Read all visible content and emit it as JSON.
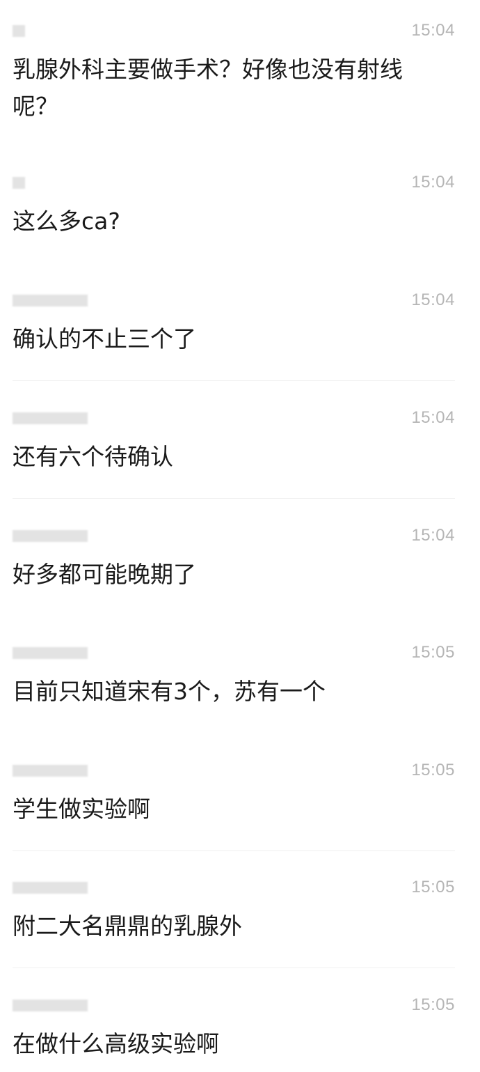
{
  "messages": [
    {
      "time": "15:04",
      "text": "乳腺外科主要做手术？好像也没有射线呢？"
    },
    {
      "time": "15:04",
      "text": "这么多ca?"
    },
    {
      "time": "15:04",
      "text": "确认的不止三个了"
    },
    {
      "time": "15:04",
      "text": "还有六个待确认"
    },
    {
      "time": "15:04",
      "text": "好多都可能晚期了"
    },
    {
      "time": "15:05",
      "text": "目前只知道宋有3个，苏有一个"
    },
    {
      "time": "15:05",
      "text": "学生做实验啊"
    },
    {
      "time": "15:05",
      "text": "附二大名鼎鼎的乳腺外"
    },
    {
      "time": "15:05",
      "text": "在做什么高级实验啊"
    }
  ]
}
